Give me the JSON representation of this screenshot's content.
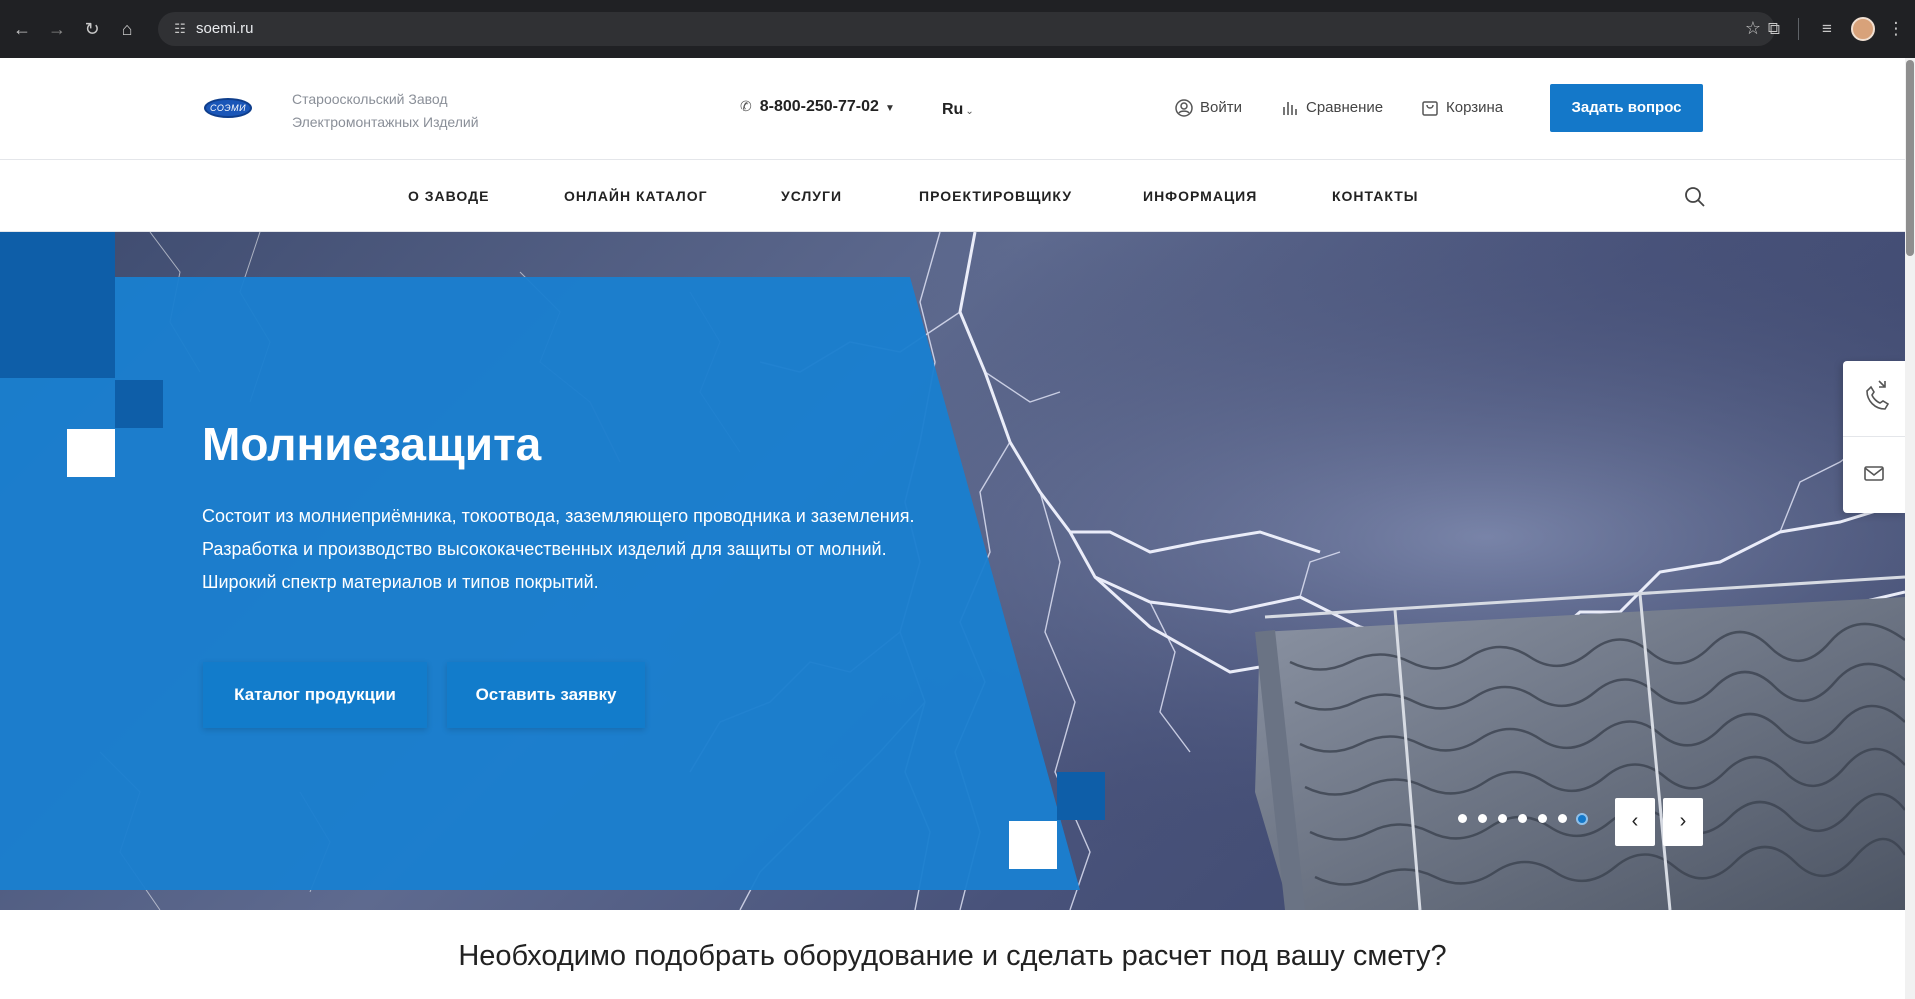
{
  "browser": {
    "url": "soemi.ru",
    "icons": [
      "back-arrow-icon",
      "forward-arrow-icon",
      "reload-icon",
      "home-icon",
      "site-settings-icon",
      "bookmark-star-icon",
      "extensions-icon",
      "reading-list-icon",
      "profile-avatar-icon",
      "menu-dots-icon"
    ]
  },
  "header": {
    "logo_text": "СОЭМИ",
    "company_line1": "Старооскольский Завод",
    "company_line2": "Электромонтажных Изделий",
    "phone": "8-800-250-77-02",
    "language": "Ru",
    "login_label": "Войти",
    "compare_label": "Сравнение",
    "cart_label": "Корзина",
    "ask_button": "Задать вопрос"
  },
  "nav": {
    "items": [
      "О ЗАВОДЕ",
      "ОНЛАЙН КАТАЛОГ",
      "УСЛУГИ",
      "ПРОЕКТИРОВЩИКУ",
      "ИНФОРМАЦИЯ",
      "КОНТАКТЫ"
    ]
  },
  "hero": {
    "title": "Молниезащита",
    "line1": "Состоит из молниеприёмника, токоотвода, заземляющего проводника и заземления.",
    "line2": "Разработка и производство высококачественных изделий для защиты от молний.",
    "line3": "Широкий спектр материалов и типов покрытий.",
    "catalog_button": "Каталог продукции",
    "request_button": "Оставить заявку",
    "slide_count": 7,
    "active_slide": 7,
    "prev_arrow": "‹",
    "next_arrow": "›"
  },
  "widget": {
    "icons": [
      "callback-phone-icon",
      "mail-envelope-icon"
    ]
  },
  "bottom": {
    "heading": "Необходимо подобрать оборудование и сделать расчет под вашу смету?"
  },
  "colors": {
    "brand_blue": "#1478c9",
    "hero_panel": "#1a7fcf",
    "chrome_bg": "#202124"
  }
}
